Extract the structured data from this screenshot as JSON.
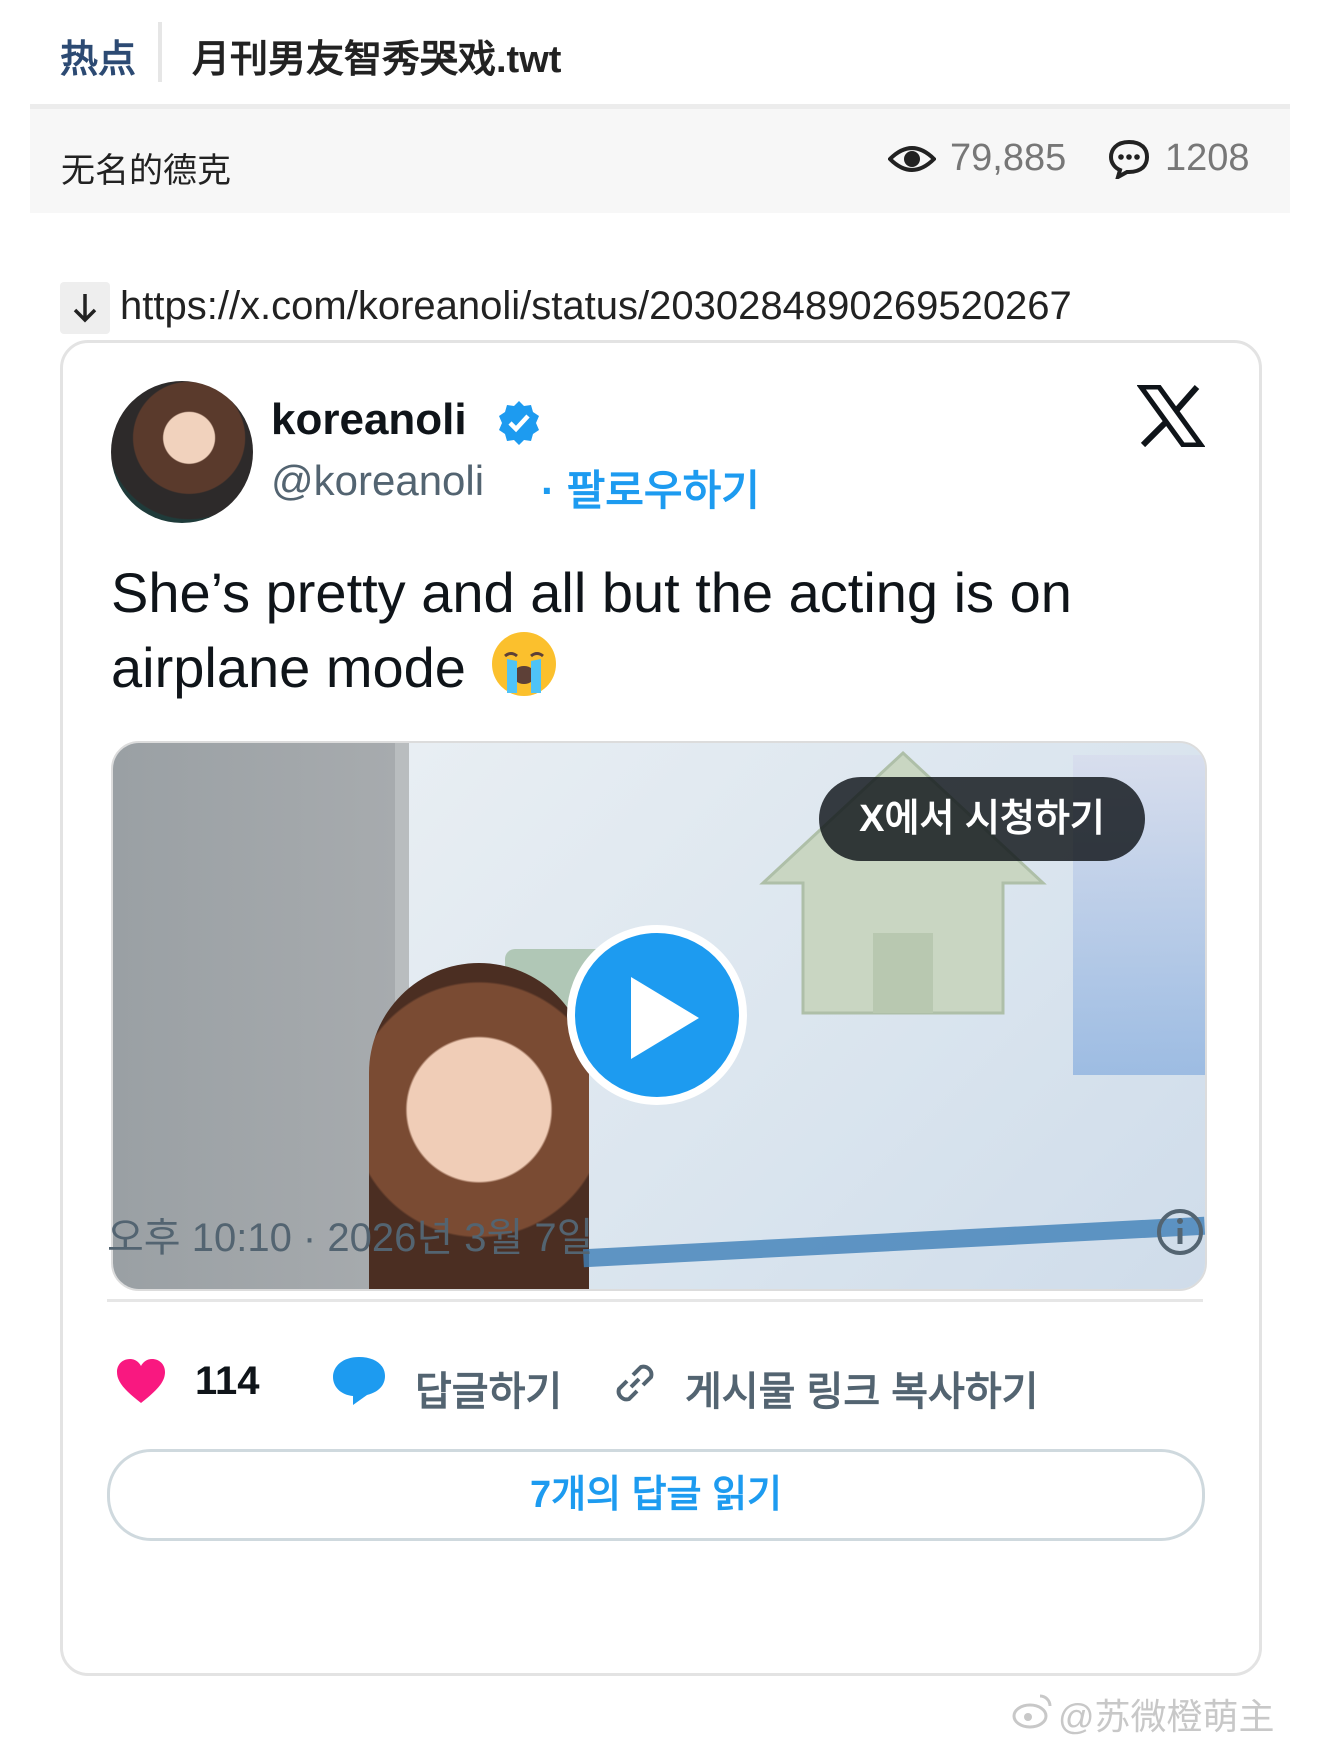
{
  "header": {
    "tag": "热点",
    "title": "月刊男友智秀哭戏.twt"
  },
  "meta": {
    "author": "无名的德克",
    "views": "79,885",
    "comments": "1208"
  },
  "link": {
    "url": "https://x.com/koreanoli/status/2030284890269520267"
  },
  "tweet": {
    "display_name": "koreanoli",
    "handle": "@koreanoli",
    "follow_label": "· 팔로우하기",
    "text": "She’s pretty and all but the acting is on airplane mode",
    "watch_label": "X에서 시청하기",
    "timestamp": "오후 10:10 · 2026년 3월 7일",
    "likes": "114",
    "reply_label": "답글하기",
    "copy_link_label": "게시물 링크 복사하기",
    "read_replies_label": "7개의 답글 읽기"
  },
  "watermark": "@苏微橙萌主",
  "colors": {
    "accent": "#1d9bf0",
    "heart": "#f91880",
    "tag": "#2c4a73"
  },
  "icons": [
    "eye-icon",
    "comment-bubble-icon",
    "download-arrow-icon",
    "verified-badge-icon",
    "x-logo-icon",
    "crying-emoji-icon",
    "play-icon",
    "info-icon",
    "heart-icon",
    "reply-bubble-icon",
    "link-icon",
    "weibo-icon"
  ]
}
